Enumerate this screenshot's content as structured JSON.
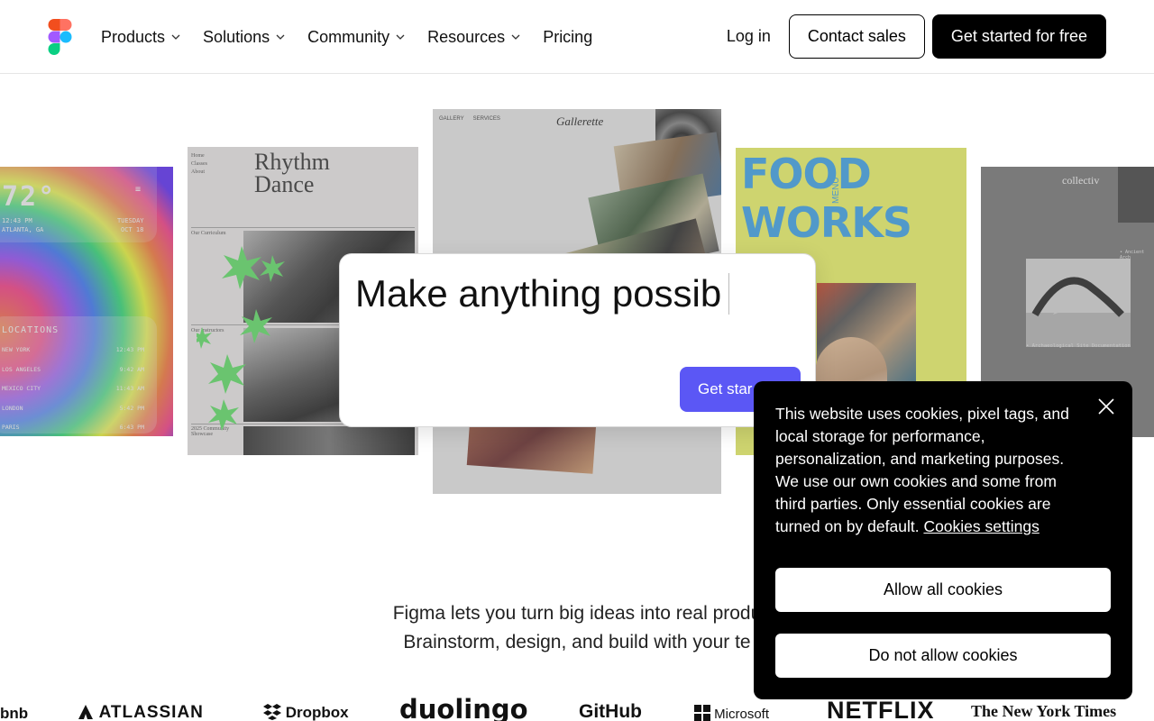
{
  "header": {
    "nav": [
      {
        "label": "Products",
        "has_dropdown": true
      },
      {
        "label": "Solutions",
        "has_dropdown": true
      },
      {
        "label": "Community",
        "has_dropdown": true
      },
      {
        "label": "Resources",
        "has_dropdown": true
      },
      {
        "label": "Pricing",
        "has_dropdown": false
      }
    ],
    "login_label": "Log in",
    "contact_label": "Contact sales",
    "cta_label": "Get started for free"
  },
  "cards": {
    "weather": {
      "temp": "72°",
      "time": "12:43 PM",
      "day": "TUESDAY",
      "city": "ATLANTA, GA",
      "date": "OCT 18",
      "locations_title": "LOCATIONS",
      "locations": [
        {
          "city": "NEW YORK",
          "time": "12:43 PM"
        },
        {
          "city": "LOS ANGELES",
          "time": "9:42 AM"
        },
        {
          "city": "MEXICO CITY",
          "time": "11:43 AM"
        },
        {
          "city": "LONDON",
          "time": "5:42 PM"
        },
        {
          "city": "PARIS",
          "time": "6:43 PM"
        }
      ]
    },
    "rhythm": {
      "title_line1": "Rhythm",
      "title_line2": "Dance",
      "menu1": "Home",
      "menu2": "Classes",
      "menu3": "About",
      "curriculum": "Our Curriculum",
      "instructors": "Our Instructors",
      "showcase1": "2025 Community",
      "showcase2": "Showcase"
    },
    "gallerette": {
      "brand": "Gallerette",
      "nav1": "GALLERY",
      "nav2": "SERVICES"
    },
    "foodworks": {
      "title": "FOOD WORKS",
      "menu": "MENU"
    },
    "collectiv": {
      "brand": "collectiv",
      "caption": "• Archaeological Site Documentation",
      "thumb_caption": "• Ancient Arch"
    }
  },
  "prompt": {
    "typed_text": "Make anything possib",
    "button_label": "Get star"
  },
  "tagline": {
    "line1": "Figma lets you turn big ideas into real produ",
    "line2": "Brainstorm, design, and build with your te"
  },
  "logos": [
    {
      "name": "bnb"
    },
    {
      "name": "ATLASSIAN"
    },
    {
      "name": "Dropbox"
    },
    {
      "name": "duolingo"
    },
    {
      "name": "GitHub"
    },
    {
      "name": "Microsoft"
    },
    {
      "name": "NETFLIX"
    },
    {
      "name": "The New York Times"
    }
  ],
  "cookie": {
    "message": "This website uses cookies, pixel tags, and local storage for performance, personalization, and marketing purposes. We use our own cookies and some from third parties. Only essential cookies are turned on by default.",
    "settings_link": "Cookies settings",
    "allow_label": "Allow all cookies",
    "deny_label": "Do not allow cookies"
  },
  "colors": {
    "accent": "#5b57f5",
    "figma_red": "#f24e1e",
    "figma_orange": "#ff7262",
    "figma_purple": "#a259ff",
    "figma_blue": "#1abcfe",
    "figma_green": "#0acf83"
  }
}
